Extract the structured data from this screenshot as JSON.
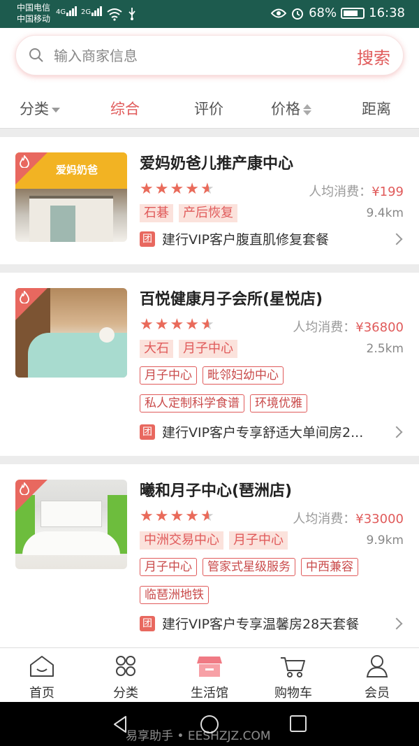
{
  "status_bar": {
    "carrier_1": "中国电信",
    "carrier_2": "中国移动",
    "net_1": "4G",
    "net_2": "2G",
    "battery": "68%",
    "time": "16:38"
  },
  "search": {
    "placeholder": "输入商家信息",
    "button": "搜索"
  },
  "filters": [
    {
      "label": "分类",
      "icon": "dropdown-arrow"
    },
    {
      "label": "综合",
      "active": true
    },
    {
      "label": "评价"
    },
    {
      "label": "价格",
      "icon": "sort-arrows"
    },
    {
      "label": "距离"
    }
  ],
  "stores": [
    {
      "name": "爱妈奶爸儿推产康中心",
      "rating": 4.5,
      "avg_label": "人均消费：",
      "avg_price": "¥199",
      "area_tags": [
        "石碁",
        "产后恢复"
      ],
      "distance": "9.4km",
      "tags": [],
      "deal_icon": "团",
      "deal": "建行VIP客户腹直肌修复套餐",
      "image_sign": "爱妈奶爸"
    },
    {
      "name": "百悦健康月子会所(星悦店)",
      "rating": 4.5,
      "avg_label": "人均消费：",
      "avg_price": "¥36800",
      "area_tags": [
        "大石",
        "月子中心"
      ],
      "distance": "2.5km",
      "tags": [
        "月子中心",
        "毗邻妇幼中心",
        "私人定制科学食谱",
        "环境优雅"
      ],
      "deal_icon": "团",
      "deal": "建行VIP客户专享舒适大单间房2..."
    },
    {
      "name": "曦和月子中心(琶洲店)",
      "rating": 4.5,
      "avg_label": "人均消费：",
      "avg_price": "¥33000",
      "area_tags": [
        "中洲交易中心",
        "月子中心"
      ],
      "distance": "9.9km",
      "tags": [
        "月子中心",
        "管家式星级服务",
        "中西兼容",
        "临琶洲地铁"
      ],
      "deal_icon": "团",
      "deal": "建行VIP客户专享温馨房28天套餐"
    }
  ],
  "tabs": [
    {
      "label": "首页",
      "icon": "home-icon"
    },
    {
      "label": "分类",
      "icon": "category-icon"
    },
    {
      "label": "生活馆",
      "icon": "store-icon",
      "active": true
    },
    {
      "label": "购物车",
      "icon": "cart-icon"
    },
    {
      "label": "会员",
      "icon": "member-icon"
    }
  ],
  "watermark": "易享助手 • EESHZJZ.COM",
  "colors": {
    "accent": "#e05a5a",
    "status_bar": "#1d5b4e",
    "star": "#e96a5a"
  }
}
